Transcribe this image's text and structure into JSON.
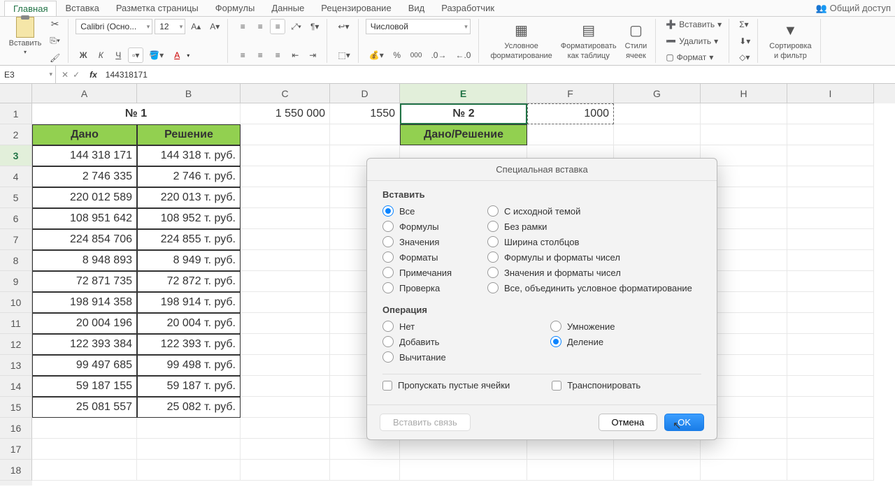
{
  "tabs": {
    "main": "Главная",
    "insert": "Вставка",
    "layout": "Разметка страницы",
    "formulas": "Формулы",
    "data": "Данные",
    "review": "Рецензирование",
    "view": "Вид",
    "developer": "Разработчик"
  },
  "share": "Общий доступ",
  "ribbon": {
    "paste": "Вставить",
    "font": "Calibri (Осно...",
    "size": "12",
    "numfmt": "Числовой",
    "cond": "Условное\nформатирование",
    "astable": "Форматировать\nкак таблицу",
    "styles": "Стили\nячеек",
    "insertr": "Вставить",
    "delete": "Удалить",
    "format": "Формат",
    "sort": "Сортировка\nи фильтр",
    "bold": "Ж",
    "italic": "К",
    "underline": "Ч",
    "font_a": "А"
  },
  "formulabar": {
    "name": "E3",
    "fx": "fx",
    "value": "144318171"
  },
  "cols": [
    "A",
    "B",
    "C",
    "D",
    "E",
    "F",
    "G",
    "H",
    "I"
  ],
  "rows": [
    "1",
    "2",
    "3",
    "4",
    "5",
    "6",
    "7",
    "8",
    "9",
    "10",
    "11",
    "12",
    "13",
    "14",
    "15",
    "16",
    "17",
    "18"
  ],
  "cells": {
    "no1": "№ 1",
    "no2": "№ 2",
    "c1": "1 550 000",
    "d1": "1550",
    "f1": "1000",
    "given": "Дано",
    "solution": "Решение",
    "combined": "Дано/Решение",
    "a": [
      "144 318 171",
      "2 746 335",
      "220 012 589",
      "108 951 642",
      "224 854 706",
      "8 948 893",
      "72 871 735",
      "198 914 358",
      "20 004 196",
      "122 393 384",
      "99 497 685",
      "59 187 155",
      "25 081 557"
    ],
    "b": [
      "144 318 т. руб.",
      "2 746 т. руб.",
      "220 013 т. руб.",
      "108 952 т. руб.",
      "224 855 т. руб.",
      "8 949 т. руб.",
      "72 872 т. руб.",
      "198 914 т. руб.",
      "20 004 т. руб.",
      "122 393 т. руб.",
      "99 498 т. руб.",
      "59 187 т. руб.",
      "25 082 т. руб."
    ]
  },
  "dialog": {
    "title": "Специальная вставка",
    "s1": "Вставить",
    "r": {
      "all": "Все",
      "formulas": "Формулы",
      "values": "Значения",
      "formats": "Форматы",
      "comments": "Примечания",
      "valid": "Проверка",
      "theme": "С исходной темой",
      "noborder": "Без рамки",
      "colw": "Ширина столбцов",
      "fnum": "Формулы и форматы чисел",
      "vnum": "Значения и форматы чисел",
      "merge": "Все, объединить условное форматирование"
    },
    "s2": "Операция",
    "op": {
      "none": "Нет",
      "add": "Добавить",
      "sub": "Вычитание",
      "mul": "Умножение",
      "div": "Деление"
    },
    "skip": "Пропускать пустые ячейки",
    "trans": "Транспонировать",
    "link": "Вставить связь",
    "cancel": "Отмена",
    "ok": "OK"
  }
}
